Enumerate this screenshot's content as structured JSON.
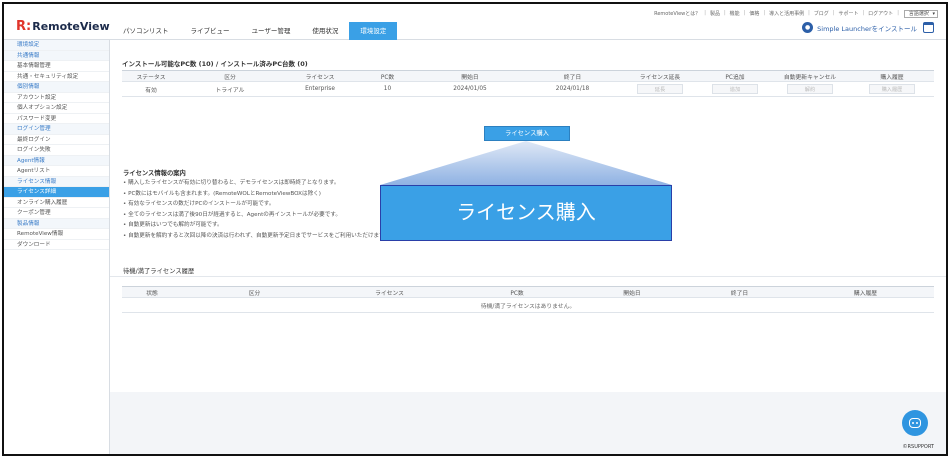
{
  "app": {
    "logo_mark": "R:",
    "logo_text": "RemoteView"
  },
  "nav": {
    "tabs": [
      {
        "label": "パソコンリスト"
      },
      {
        "label": "ライブビュー"
      },
      {
        "label": "ユーザー管理"
      },
      {
        "label": "使用状況"
      },
      {
        "label": "環境設定",
        "active": true
      }
    ]
  },
  "toplinks": [
    "RemoteViewとは？",
    "製品",
    "機能",
    "価格",
    "導入と活用事例",
    "ブログ",
    "サポート",
    "ログアウト"
  ],
  "language_select": "言語選択",
  "launcher": {
    "label": "Simple Launcherをインストール"
  },
  "sidebar": {
    "items": [
      {
        "label": "環境設定",
        "type": "section"
      },
      {
        "label": "共通情報",
        "type": "section"
      },
      {
        "label": "基本情報管理",
        "type": "item"
      },
      {
        "label": "共通・セキュリティ設定",
        "type": "item"
      },
      {
        "label": "個別情報",
        "type": "section"
      },
      {
        "label": "アカウント設定",
        "type": "item"
      },
      {
        "label": "個人オプション設定",
        "type": "item"
      },
      {
        "label": "パスワード変更",
        "type": "item"
      },
      {
        "label": "ログイン管理",
        "type": "section"
      },
      {
        "label": "最終ログイン",
        "type": "item"
      },
      {
        "label": "ログイン失敗",
        "type": "item"
      },
      {
        "label": "Agent情報",
        "type": "section"
      },
      {
        "label": "Agentリスト",
        "type": "item"
      },
      {
        "label": "ライセンス情報",
        "type": "section"
      },
      {
        "label": "ライセンス詳細",
        "type": "active"
      },
      {
        "label": "オンライン購入履歴",
        "type": "item"
      },
      {
        "label": "クーポン管理",
        "type": "item"
      },
      {
        "label": "製品情報",
        "type": "section"
      },
      {
        "label": "RemoteView情報",
        "type": "item"
      },
      {
        "label": "ダウンロード",
        "type": "item"
      }
    ]
  },
  "license": {
    "title": "インストール可能なPC数 (10) / インストール済みPC台数 (0)",
    "headers": [
      "ステータス",
      "区分",
      "ライセンス",
      "PC数",
      "開始日",
      "終了日",
      "ライセンス延長",
      "PC追加",
      "自動更新キャンセル",
      "購入履歴"
    ],
    "row": [
      "有効",
      "トライアル",
      "Enterprise",
      "10",
      "2024/01/05",
      "2024/01/18"
    ],
    "buttons": [
      "延長",
      "追加",
      "解約",
      "購入履歴"
    ],
    "buy_button": "ライセンス購入",
    "buy_zoom": "ライセンス購入"
  },
  "info": {
    "title": "ライセンス情報の案内",
    "lines": [
      "• 購入したライセンスが有効に切り替わると、デモライセンスは即時終了となります。",
      "• PC数にはモバイルも含まれます。(RemoteWOLとRemoteViewBOXは除く)",
      "• 有効なライセンスの数だけPCのインストールが可能です。",
      "• 全てのライセンスは満了後90日が経過すると、Agentの再インストールが必要です。",
      "• 自動更新はいつでも解約が可能です。",
      "• 自動更新を解約すると次回以降の決済は行われず、自動更新予定日までサービスをご利用いただけます。"
    ]
  },
  "history": {
    "title": "待機/満了ライセンス履歴",
    "headers": [
      "状態",
      "区分",
      "ライセンス",
      "PC数",
      "開始日",
      "終了日",
      "購入履歴"
    ],
    "empty": "待機/満了ライセンスはありません。"
  },
  "footer": {
    "copyright": "©RSUPPORT"
  }
}
